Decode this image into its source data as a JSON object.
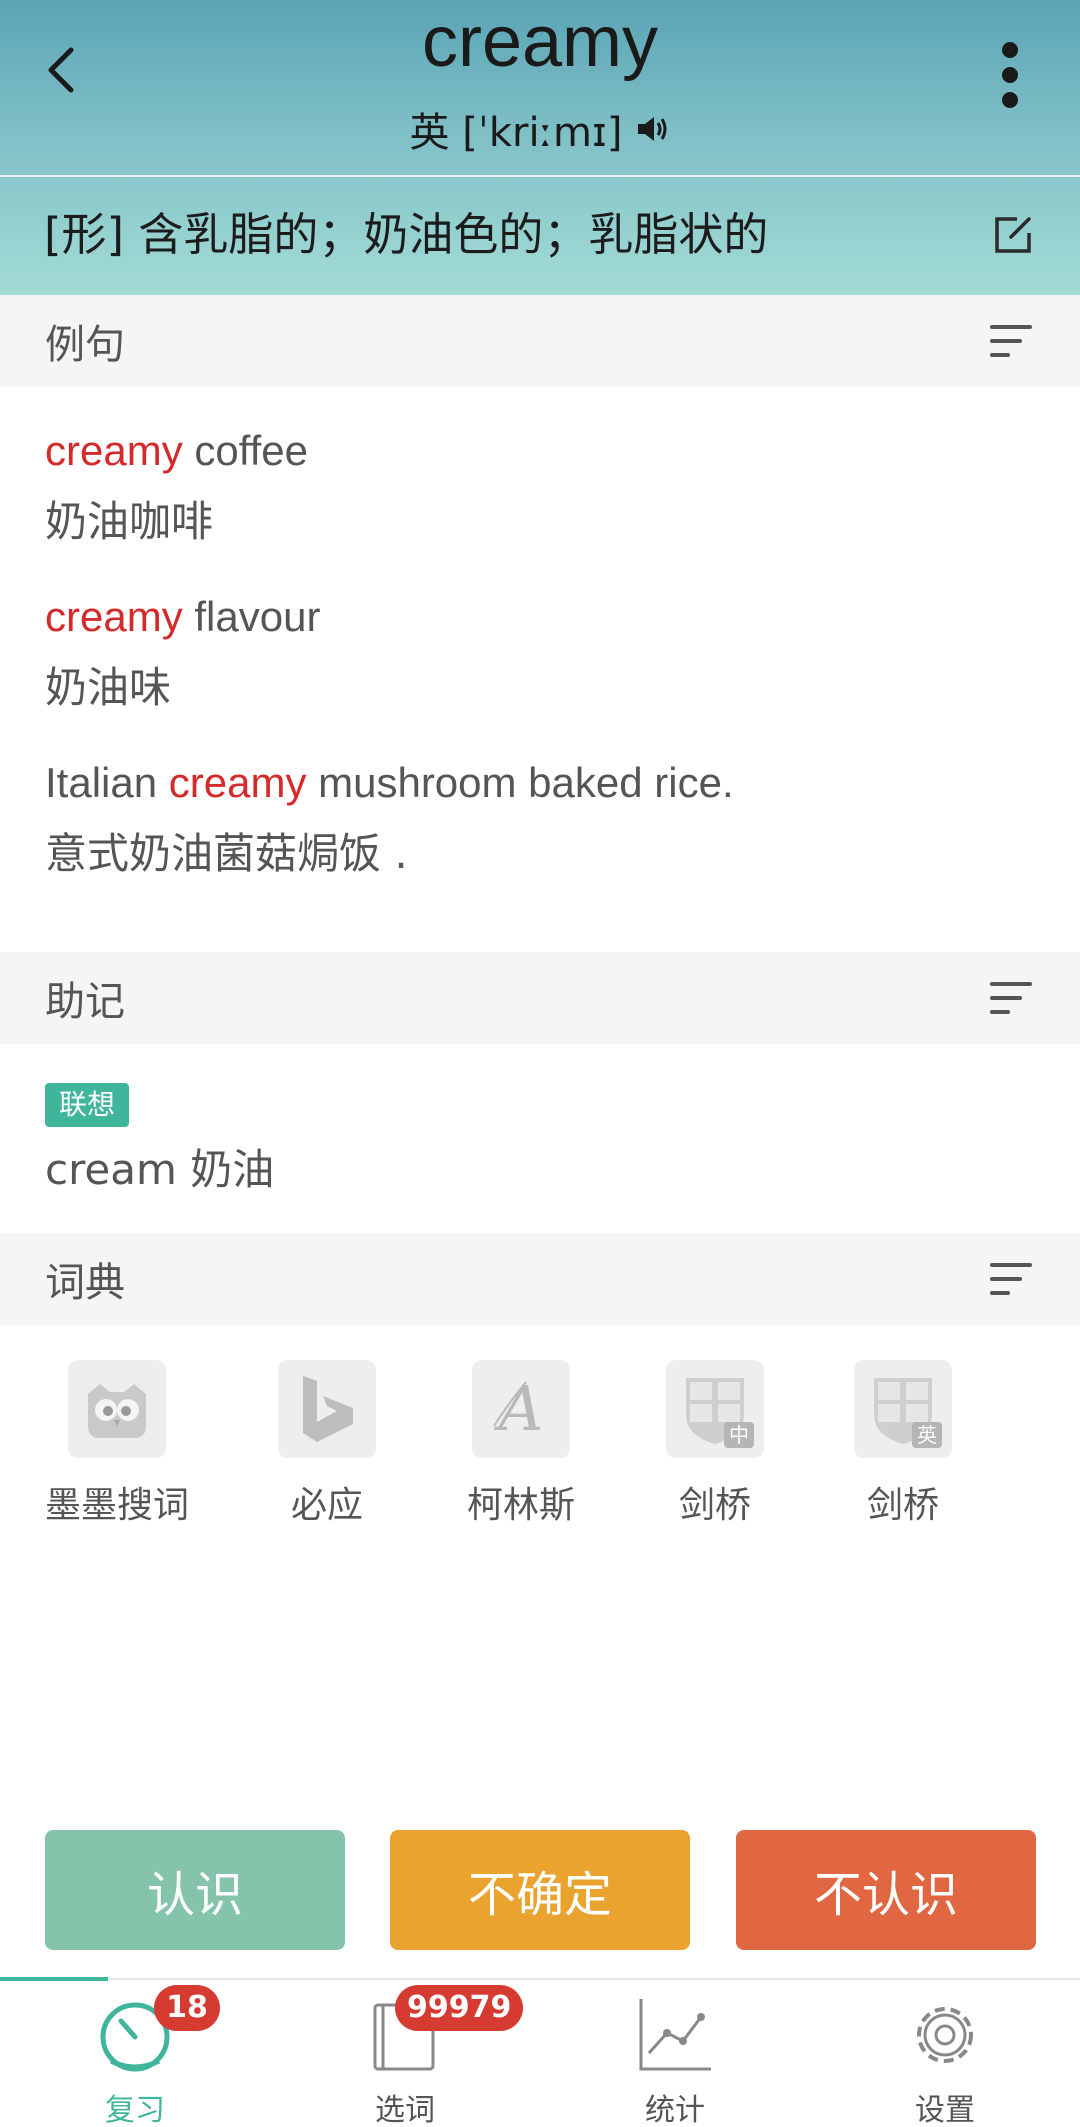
{
  "header": {
    "word": "creamy",
    "phonetic": "英 [ˈkriːmɪ]",
    "definition": "[形] 含乳脂的；奶油色的；乳脂状的"
  },
  "sections": {
    "examples_title": "例句",
    "mnemonic_title": "助记",
    "dictionary_title": "词典"
  },
  "examples": [
    {
      "before": "",
      "highlight": "creamy",
      "after": " coffee",
      "zh": "奶油咖啡"
    },
    {
      "before": "",
      "highlight": "creamy",
      "after": " flavour",
      "zh": "奶油味"
    },
    {
      "before": "Italian ",
      "highlight": "creamy",
      "after": " mushroom baked rice.",
      "zh": "意式奶油菌菇焗饭 ."
    }
  ],
  "mnemonic": {
    "tag": "联想",
    "text": "cream  奶油"
  },
  "dictionaries": [
    {
      "label": "墨墨搜词",
      "icon": "owl-icon"
    },
    {
      "label": "必应",
      "icon": "bing-icon"
    },
    {
      "label": "柯林斯",
      "icon": "collins-icon"
    },
    {
      "label": "剑桥",
      "icon": "cambridge-cn-icon",
      "corner": "中"
    },
    {
      "label": "剑桥",
      "icon": "cambridge-en-icon",
      "corner": "英"
    }
  ],
  "actions": {
    "know": "认识",
    "unsure": "不确定",
    "unknown": "不认识"
  },
  "tabs": [
    {
      "label": "复习",
      "badge": "18",
      "icon": "timer-icon",
      "active": true
    },
    {
      "label": "选词",
      "badge": "99979",
      "icon": "book-icon",
      "active": false
    },
    {
      "label": "统计",
      "badge": "",
      "icon": "chart-icon",
      "active": false
    },
    {
      "label": "设置",
      "badge": "",
      "icon": "gear-icon",
      "active": false
    }
  ],
  "colors": {
    "accent": "#3fb59b",
    "highlight": "#d42a2a",
    "know": "#85c3aa",
    "unsure": "#eba32f",
    "unknown": "#e06741",
    "badge": "#d63b32"
  }
}
